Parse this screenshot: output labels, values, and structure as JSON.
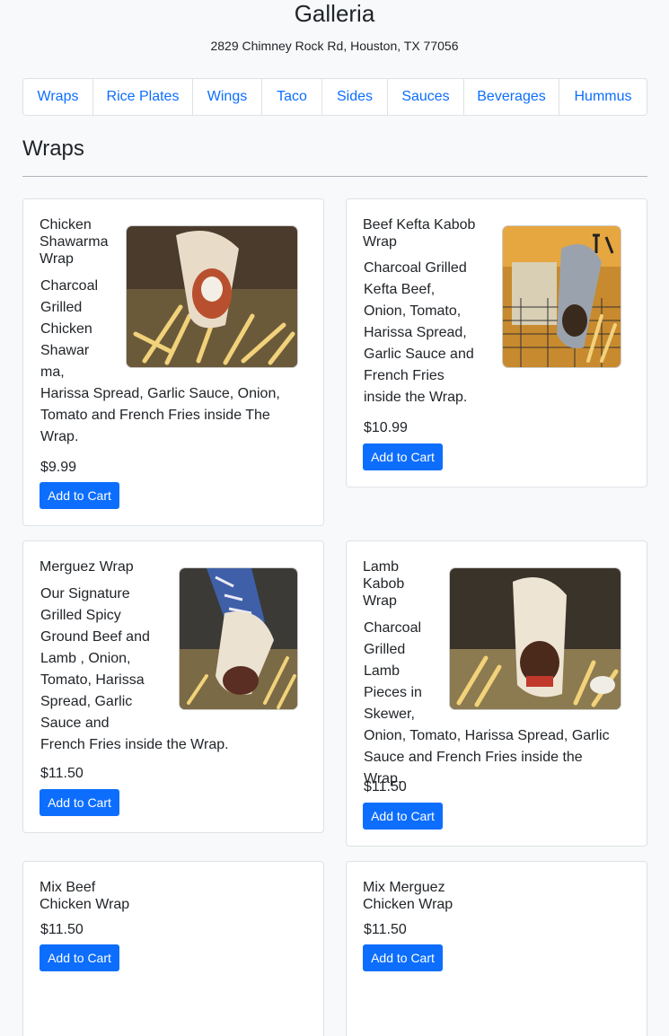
{
  "store": {
    "name": "Galleria",
    "address": "2829 Chimney Rock Rd, Houston, TX 77056"
  },
  "tabs": [
    {
      "label": "Wraps"
    },
    {
      "label": "Rice Plates"
    },
    {
      "label": "Wings"
    },
    {
      "label": "Taco"
    },
    {
      "label": "Sides"
    },
    {
      "label": "Sauces"
    },
    {
      "label": "Beverages"
    },
    {
      "label": "Hummus"
    }
  ],
  "section": {
    "title": "Wraps"
  },
  "add_to_cart_label": "Add to Cart",
  "items": [
    {
      "name": "Chicken Shawarma Wrap",
      "description": "Charcoal Grilled Chicken Shawarma, Harissa Spread, Garlic Sauce, Onion, Tomato and French Fries inside The Wrap.",
      "price": "$9.99"
    },
    {
      "name": "Beef Kefta Kabob Wrap",
      "description": "Charcoal Grilled Kefta Beef, Onion, Tomato, Harissa Spread, Garlic Sauce and French Fries inside the Wrap.",
      "price": "$10.99"
    },
    {
      "name": "Merguez Wrap",
      "description": "Our Signature Grilled Spicy Ground Beef and Lamb , Onion, Tomato, Harissa Spread, Garlic Sauce and French Fries inside the Wrap.",
      "price": "$11.50"
    },
    {
      "name": "Lamb Kabob Wrap",
      "description": "Charcoal Grilled Lamb Pieces in Skewer, Onion, Tomato, Harissa Spread, Garlic Sauce and French Fries inside the Wrap.",
      "price": "$11.50"
    },
    {
      "name": "Mix Beef Chicken Wrap",
      "description": "",
      "price": "$11.50"
    },
    {
      "name": "Mix Merguez Chicken Wrap",
      "description": "",
      "price": "$11.50"
    }
  ]
}
